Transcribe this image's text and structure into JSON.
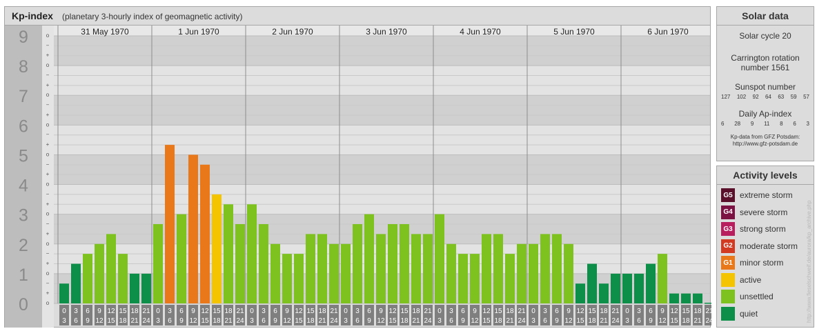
{
  "header": {
    "title": "Kp-index",
    "subtitle": "(planetary 3-hourly index of geomagnetic activity)"
  },
  "chart_data": {
    "type": "bar",
    "y_axis_labels": [
      "0",
      "1",
      "2",
      "3",
      "4",
      "5",
      "6",
      "7",
      "8",
      "9"
    ],
    "sub_marks": [
      "o",
      "+",
      "−"
    ],
    "ylim": [
      0,
      9
    ],
    "days": [
      "31 May 1970",
      "1 Jun 1970",
      "2 Jun 1970",
      "3 Jun 1970",
      "4 Jun 1970",
      "5 Jun 1970",
      "6 Jun 1970"
    ],
    "time_start_labels": [
      "0",
      "3",
      "6",
      "9",
      "12",
      "15",
      "18",
      "21"
    ],
    "time_end_labels": [
      "3",
      "6",
      "9",
      "12",
      "15",
      "18",
      "21",
      "24"
    ],
    "values": [
      0.667,
      1.333,
      1.667,
      2.0,
      2.333,
      1.667,
      1.0,
      1.0,
      2.667,
      5.333,
      3.0,
      5.0,
      4.667,
      3.667,
      3.333,
      2.667,
      3.333,
      2.667,
      2.0,
      1.667,
      1.667,
      2.333,
      2.333,
      2.0,
      2.0,
      2.667,
      3.0,
      2.333,
      2.667,
      2.667,
      2.333,
      2.333,
      3.0,
      2.0,
      1.667,
      1.667,
      2.333,
      2.333,
      1.667,
      2.0,
      2.0,
      2.333,
      2.333,
      2.0,
      0.667,
      1.333,
      0.667,
      1.0,
      1.0,
      1.0,
      1.333,
      1.667,
      0.333,
      0.333,
      0.333,
      0.0
    ],
    "levels": [
      "quiet",
      "quiet",
      "unsettled",
      "unsettled",
      "unsettled",
      "unsettled",
      "quiet",
      "quiet",
      "unsettled",
      "minor",
      "unsettled",
      "minor",
      "minor",
      "active",
      "unsettled",
      "unsettled",
      "unsettled",
      "unsettled",
      "unsettled",
      "unsettled",
      "unsettled",
      "unsettled",
      "unsettled",
      "unsettled",
      "unsettled",
      "unsettled",
      "unsettled",
      "unsettled",
      "unsettled",
      "unsettled",
      "unsettled",
      "unsettled",
      "unsettled",
      "unsettled",
      "unsettled",
      "unsettled",
      "unsettled",
      "unsettled",
      "unsettled",
      "unsettled",
      "unsettled",
      "unsettled",
      "unsettled",
      "unsettled",
      "quiet",
      "quiet",
      "quiet",
      "quiet",
      "quiet",
      "quiet",
      "quiet",
      "unsettled",
      "quiet",
      "quiet",
      "quiet",
      "quiet"
    ],
    "level_colors": {
      "quiet": "#0d8f4a",
      "unsettled": "#7dc21e",
      "active": "#f5c400",
      "minor": "#e8781a"
    },
    "grid": true
  },
  "solar": {
    "title": "Solar data",
    "cycle": "Solar cycle 20",
    "carrington_line1": "Carrington rotation",
    "carrington_line2": "number 1561",
    "sunspot_title": "Sunspot number",
    "sunspot_values": [
      "127",
      "102",
      "92",
      "64",
      "63",
      "59",
      "57"
    ],
    "ap_title": "Daily Ap-index",
    "ap_values": [
      "6",
      "28",
      "9",
      "11",
      "8",
      "6",
      "3"
    ],
    "credit_line1": "Kp-data from GFZ Potsdam:",
    "credit_line2": "http://www.gfz-potsdam.de"
  },
  "levels": {
    "title": "Activity levels",
    "items": [
      {
        "code": "G5",
        "label": "extreme storm",
        "color": "#5a0f2a"
      },
      {
        "code": "G4",
        "label": "severe storm",
        "color": "#7c1244"
      },
      {
        "code": "G3",
        "label": "strong storm",
        "color": "#b81e5d"
      },
      {
        "code": "G2",
        "label": "moderate storm",
        "color": "#d23a22"
      },
      {
        "code": "G1",
        "label": "minor storm",
        "color": "#e8781a"
      },
      {
        "code": "",
        "label": "active",
        "color": "#f5c400"
      },
      {
        "code": "",
        "label": "unsettled",
        "color": "#7dc21e"
      },
      {
        "code": "",
        "label": "quiet",
        "color": "#0d8f4a"
      }
    ]
  },
  "watermark": "http://www.fieselschweif.de/aurora/kp_archive.php"
}
